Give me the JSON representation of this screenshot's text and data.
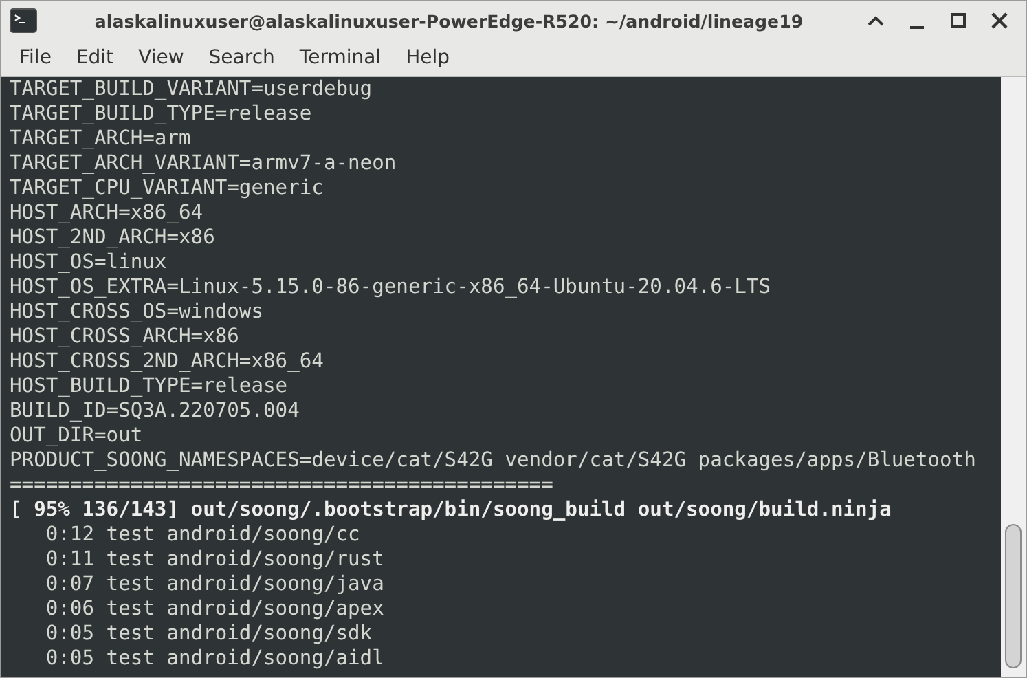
{
  "window": {
    "title": "alaskalinuxuser@alaskalinuxuser-PowerEdge-R520: ~/android/lineage19"
  },
  "menu": [
    "File",
    "Edit",
    "View",
    "Search",
    "Terminal",
    "Help"
  ],
  "terminal": {
    "lines": [
      {
        "text": "TARGET_BUILD_VARIANT=userdebug",
        "kind": "plain"
      },
      {
        "text": "TARGET_BUILD_TYPE=release",
        "kind": "plain"
      },
      {
        "text": "TARGET_ARCH=arm",
        "kind": "plain"
      },
      {
        "text": "TARGET_ARCH_VARIANT=armv7-a-neon",
        "kind": "plain"
      },
      {
        "text": "TARGET_CPU_VARIANT=generic",
        "kind": "plain"
      },
      {
        "text": "HOST_ARCH=x86_64",
        "kind": "plain"
      },
      {
        "text": "HOST_2ND_ARCH=x86",
        "kind": "plain"
      },
      {
        "text": "HOST_OS=linux",
        "kind": "plain"
      },
      {
        "text": "HOST_OS_EXTRA=Linux-5.15.0-86-generic-x86_64-Ubuntu-20.04.6-LTS",
        "kind": "plain"
      },
      {
        "text": "HOST_CROSS_OS=windows",
        "kind": "plain"
      },
      {
        "text": "HOST_CROSS_ARCH=x86",
        "kind": "plain"
      },
      {
        "text": "HOST_CROSS_2ND_ARCH=x86_64",
        "kind": "plain"
      },
      {
        "text": "HOST_BUILD_TYPE=release",
        "kind": "plain"
      },
      {
        "text": "BUILD_ID=SQ3A.220705.004",
        "kind": "plain"
      },
      {
        "text": "OUT_DIR=out",
        "kind": "plain"
      },
      {
        "text": "PRODUCT_SOONG_NAMESPACES=device/cat/S42G vendor/cat/S42G packages/apps/Bluetooth",
        "kind": "plain"
      },
      {
        "text": "=============================================",
        "kind": "plain"
      },
      {
        "text": "[ 95% 136/143] out/soong/.bootstrap/bin/soong_build out/soong/build.ninja",
        "kind": "bold"
      },
      {
        "text": "   0:12 test android/soong/cc",
        "kind": "plain"
      },
      {
        "text": "   0:11 test android/soong/rust",
        "kind": "plain"
      },
      {
        "text": "   0:07 test android/soong/java",
        "kind": "plain"
      },
      {
        "text": "   0:06 test android/soong/apex",
        "kind": "plain"
      },
      {
        "text": "   0:05 test android/soong/sdk",
        "kind": "plain"
      },
      {
        "text": "   0:05 test android/soong/aidl",
        "kind": "plain"
      }
    ]
  }
}
